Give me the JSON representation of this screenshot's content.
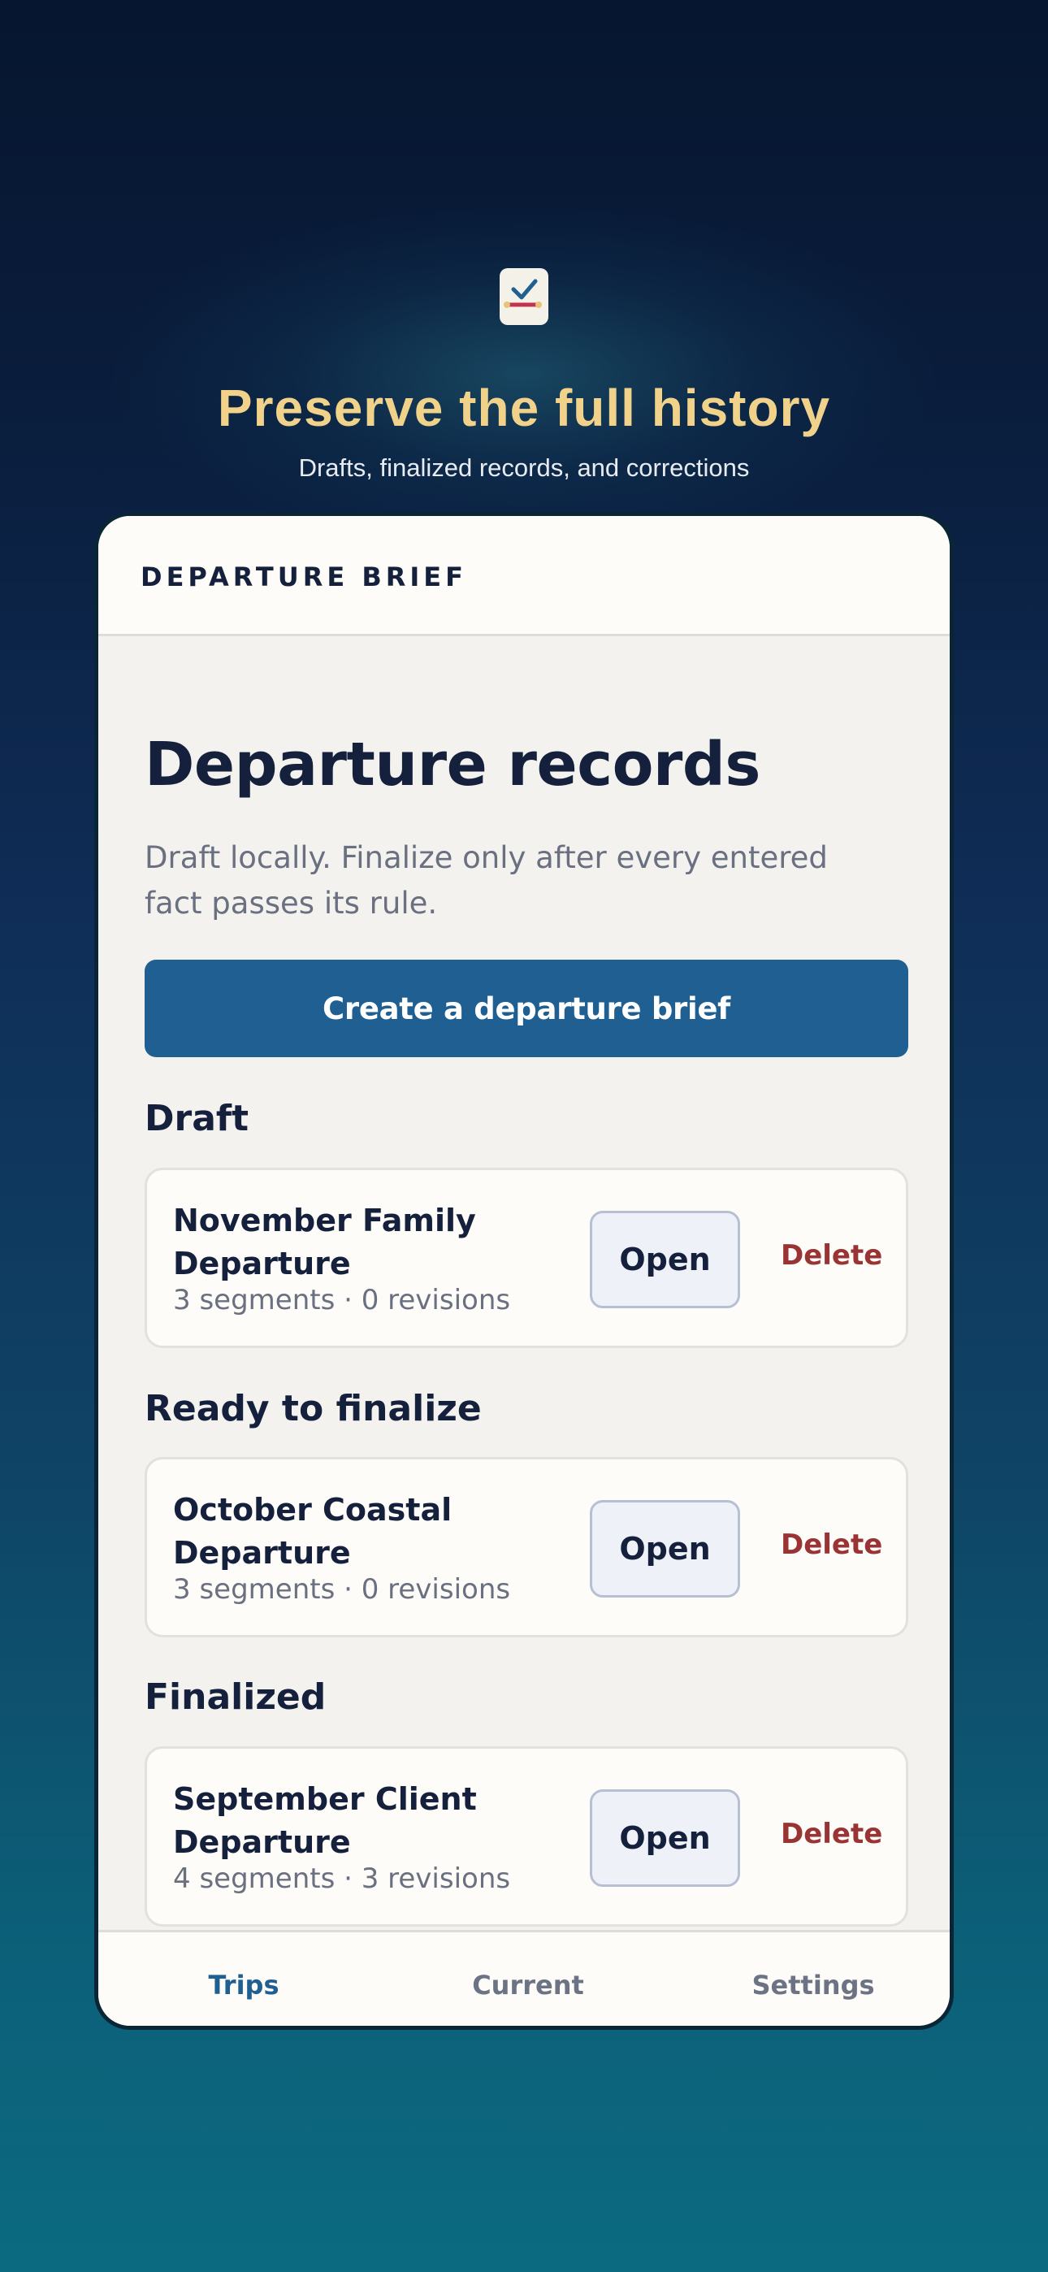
{
  "hero": {
    "icon": "checklist-icon",
    "title": "Preserve the full history",
    "subtitle": "Drafts, finalized records, and corrections"
  },
  "app": {
    "brand": "DEPARTURE BRIEF"
  },
  "main": {
    "title": "Departure records",
    "description": "Draft locally. Finalize only after every entered fact passes its rule.",
    "create_button": "Create a departure brief"
  },
  "sections": [
    {
      "heading": "Draft",
      "records": [
        {
          "title": "November Family Departure",
          "meta": "3 segments · 0 revisions",
          "open_label": "Open",
          "delete_label": "Delete"
        }
      ]
    },
    {
      "heading": "Ready to finalize",
      "records": [
        {
          "title": "October Coastal Departure",
          "meta": "3 segments · 0 revisions",
          "open_label": "Open",
          "delete_label": "Delete"
        }
      ]
    },
    {
      "heading": "Finalized",
      "records": [
        {
          "title": "September Client Departure",
          "meta": "4 segments · 3 revisions",
          "open_label": "Open",
          "delete_label": "Delete"
        }
      ]
    }
  ],
  "nav": {
    "items": [
      {
        "label": "Trips",
        "active": true
      },
      {
        "label": "Current",
        "active": false
      },
      {
        "label": "Settings",
        "active": false
      }
    ]
  },
  "colors": {
    "accent": "#1f5f91",
    "hero_title": "#f1d28b",
    "danger": "#9a3434",
    "ink": "#15203d"
  }
}
